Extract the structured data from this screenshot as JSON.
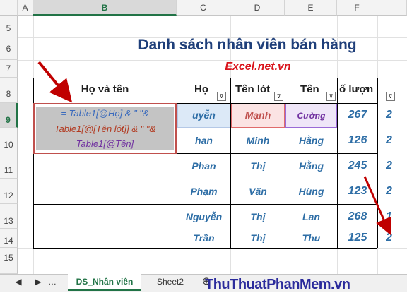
{
  "columns": [
    "A",
    "B",
    "C",
    "D",
    "E",
    "F"
  ],
  "rows": [
    "5",
    "6",
    "7",
    "8",
    "9",
    "10",
    "11",
    "12",
    "13",
    "14",
    "15"
  ],
  "title": "Danh sách nhân viên bán hàng",
  "subtitle": "Excel.net.vn",
  "headers": {
    "ho_va_ten": "Họ và tên",
    "ho": "Họ",
    "ten_lot": "Tên lót",
    "ten": "Tên",
    "so_luong": "ố lượn"
  },
  "formula": {
    "line1": "= Table1[@Họ] & \" \"&",
    "line2": "Table1[@[Tên lót]] & \" \"&",
    "line3": "Table1[@Tên]"
  },
  "data": [
    {
      "ho": "uyễn",
      "ten_lot": "Mạnh",
      "ten": "Cường",
      "so": "267"
    },
    {
      "ho": "han",
      "ten_lot": "Minh",
      "ten": "Hằng",
      "so": "126"
    },
    {
      "ho": "Phan",
      "ten_lot": "Thị",
      "ten": "Hằng",
      "so": "245"
    },
    {
      "ho": "Phạm",
      "ten_lot": "Văn",
      "ten": "Hùng",
      "so": "123"
    },
    {
      "ho": "Nguyễn",
      "ten_lot": "Thị",
      "ten": "Lan",
      "so": "268"
    },
    {
      "ho": "Trần",
      "ten_lot": "Thị",
      "ten": "Thu",
      "so": "125"
    }
  ],
  "sheet_tabs": {
    "active": "DS_Nhân viên",
    "other": "Sheet2"
  },
  "watermark": "ThuThuatPhanMem.vn"
}
